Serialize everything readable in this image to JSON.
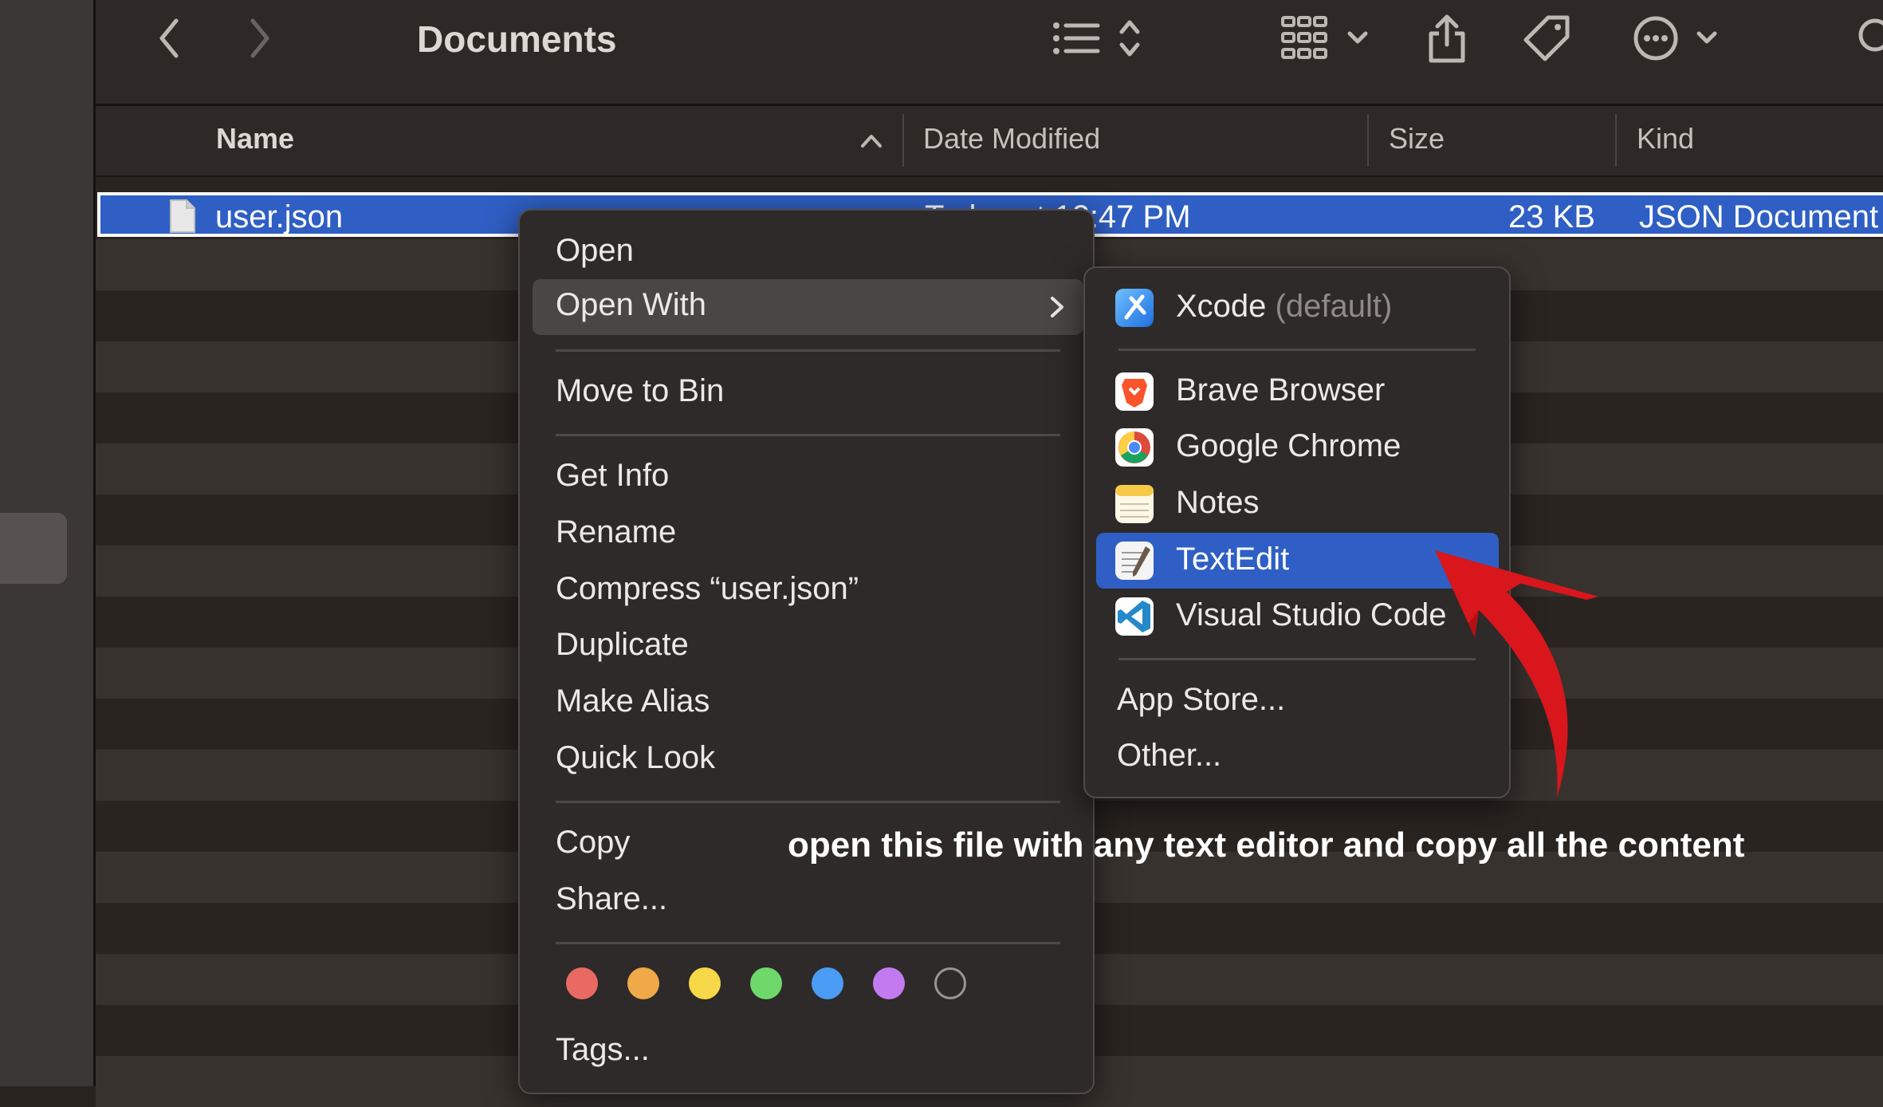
{
  "toolbar": {
    "title": "Documents",
    "back_icon": "chevron-left-icon",
    "forward_icon": "chevron-right-icon",
    "sort_icon": "list-sort-icon",
    "group_icon": "grid-icon",
    "share_icon": "share-icon",
    "tag_icon": "tag-icon",
    "more_icon": "ellipsis-circle-icon",
    "search_icon": "search-icon"
  },
  "columns": {
    "name": "Name",
    "date_modified": "Date Modified",
    "size": "Size",
    "kind": "Kind"
  },
  "file": {
    "name": "user.json",
    "date": "Today at 12:47 PM",
    "size": "23 KB",
    "kind": "JSON Document"
  },
  "context_menu": {
    "open": "Open",
    "open_with": "Open With",
    "move_to_bin": "Move to Bin",
    "get_info": "Get Info",
    "rename": "Rename",
    "compress": "Compress “user.json”",
    "duplicate": "Duplicate",
    "make_alias": "Make Alias",
    "quick_look": "Quick Look",
    "copy": "Copy",
    "share": "Share...",
    "tags": "Tags..."
  },
  "tag_colors": [
    "#e86a63",
    "#f0a948",
    "#f6d848",
    "#6fd86a",
    "#4a9cf5",
    "#c37af0",
    "none"
  ],
  "submenu": {
    "xcode": "Xcode",
    "xcode_default": "(default)",
    "brave": "Brave Browser",
    "chrome": "Google Chrome",
    "notes": "Notes",
    "textedit": "TextEdit",
    "vscode": "Visual Studio Code",
    "app_store": "App Store...",
    "other": "Other..."
  },
  "annotation": "open this file with any text editor and copy all the content",
  "colors": {
    "selection": "#2f5fc4",
    "annotation_arrow": "#d8161c"
  }
}
